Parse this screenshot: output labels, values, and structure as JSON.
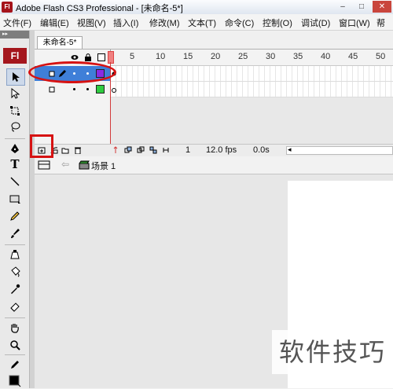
{
  "window": {
    "title": "Adobe Flash CS3 Professional - [未命名-5*]",
    "icon_text": "Fl"
  },
  "window_controls": {
    "minimize": "–",
    "maximize": "□",
    "close": "✕"
  },
  "menu": [
    "文件(F)",
    "编辑(E)",
    "视图(V)",
    "插入(I)",
    "修改(M)",
    "文本(T)",
    "命令(C)",
    "控制(O)",
    "调试(D)",
    "窗口(W)",
    "帮"
  ],
  "tools_panel": {
    "grip_label": "▸▸",
    "logo": "Fl"
  },
  "document_tab": "未命名-5*",
  "timeline": {
    "ruler_numbers": [
      "5",
      "10",
      "15",
      "20",
      "25",
      "30",
      "35",
      "40",
      "45",
      "50"
    ],
    "layers": [
      {
        "name": "",
        "selected": true,
        "outline_color": "#8a2be2"
      },
      {
        "name": "",
        "selected": false,
        "outline_color": "#2ecc40"
      }
    ],
    "current_frame": "1",
    "fps": "12.0 fps",
    "elapsed": "0.0s"
  },
  "scene": {
    "label": "场景 1"
  },
  "watermark": "软件技巧",
  "colors": {
    "highlight": "#d61212",
    "selected_layer": "#3f7fd8",
    "logo": "#a4161c"
  }
}
